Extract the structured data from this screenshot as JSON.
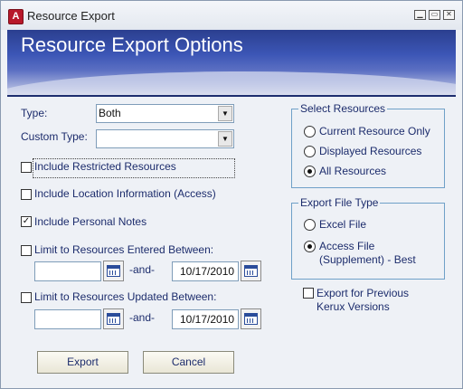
{
  "window": {
    "title": "Resource Export",
    "app_icon_letter": "A"
  },
  "banner": {
    "title": "Resource Export Options"
  },
  "form": {
    "type_label": "Type:",
    "type_value": "Both",
    "custom_type_label": "Custom Type:",
    "custom_type_value": "",
    "include_restricted": {
      "label": "Include Restricted Resources",
      "checked": false
    },
    "include_location": {
      "label": "Include Location Information (Access)",
      "checked": false
    },
    "include_notes": {
      "label": "Include Personal Notes",
      "checked": true
    },
    "limit_entered": {
      "label": "Limit to Resources Entered Between:",
      "checked": false,
      "from": "",
      "and_label": "-and-",
      "to": "10/17/2010"
    },
    "limit_updated": {
      "label": "Limit to Resources Updated Between:",
      "checked": false,
      "from": "",
      "and_label": "-and-",
      "to": "10/17/2010"
    }
  },
  "select_resources": {
    "title": "Select Resources",
    "options": [
      "Current Resource Only",
      "Displayed Resources",
      "All Resources"
    ],
    "selected": "All Resources"
  },
  "export_file_type": {
    "title": "Export File Type",
    "options": [
      "Excel File",
      "Access File (Supplement) - Best"
    ],
    "access_line1": "Access File",
    "access_line2": "(Supplement) - Best",
    "selected": "Access File (Supplement) - Best"
  },
  "previous_versions": {
    "line1": "Export for Previous",
    "line2": "Kerux Versions",
    "checked": false
  },
  "buttons": {
    "export": "Export",
    "cancel": "Cancel"
  },
  "icons": {
    "window_controls": [
      "minimize-icon",
      "restore-icon",
      "close-icon"
    ],
    "calendar": "calendar-icon",
    "dropdown": "chevron-down-icon"
  }
}
